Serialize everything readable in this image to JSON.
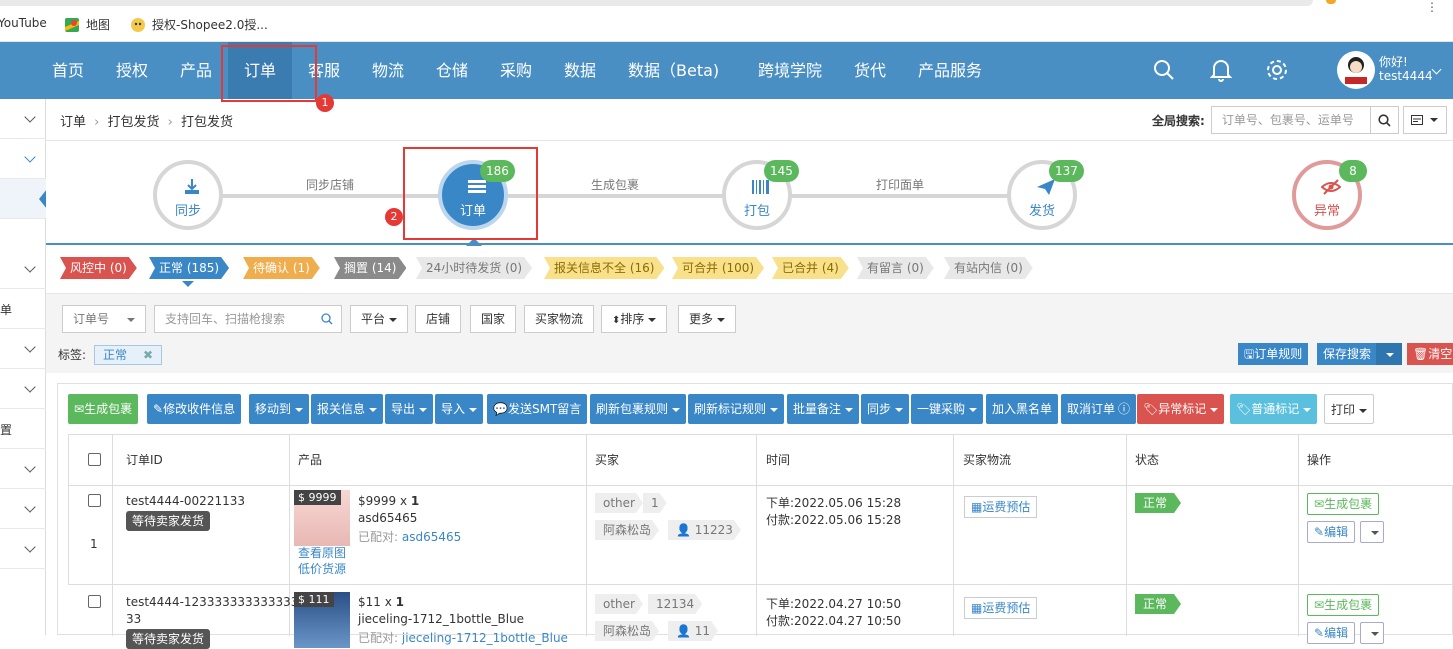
{
  "bookmarks": [
    "YouTube",
    "地图",
    "授权-Shopee2.0授..."
  ],
  "nav": {
    "items": [
      "首页",
      "授权",
      "产品",
      "订单",
      "客服",
      "物流",
      "仓储",
      "采购",
      "数据",
      "数据（Beta)",
      "跨境学院",
      "货代",
      "产品服务"
    ],
    "greeting": "你好!",
    "username": "test4444",
    "annotation1": "1"
  },
  "breadcrumb": {
    "a": "订单",
    "b": "打包发货",
    "c": "打包发货"
  },
  "global_search": {
    "label": "全局搜索:",
    "placeholder": "订单号、包裹号、运单号"
  },
  "flow": {
    "steps": [
      {
        "label": "同步",
        "count": ""
      },
      {
        "label": "订单",
        "count": "186"
      },
      {
        "label": "打包",
        "count": "145"
      },
      {
        "label": "发货",
        "count": "137"
      },
      {
        "label": "异常",
        "count": "8"
      }
    ],
    "links": [
      "同步店铺",
      "生成包裹",
      "打印面单"
    ],
    "annotation2": "2"
  },
  "status_tags": [
    {
      "label": "风控中 (0)",
      "color": "#d9534f"
    },
    {
      "label": "正常 (185)",
      "color": "#3a87c8"
    },
    {
      "label": "待确认 (1)",
      "color": "#f0ad4e"
    },
    {
      "label": "搁置 (14)",
      "color": "#8a8a8a"
    },
    {
      "label": "24小时待发货 (0)",
      "color": "#e8e8e8"
    },
    {
      "label": "报关信息不全 (16)",
      "color": "#f9e08a"
    },
    {
      "label": "可合并 (100)",
      "color": "#f9e08a"
    },
    {
      "label": "已合并 (4)",
      "color": "#f9e08a"
    },
    {
      "label": "有留言 (0)",
      "color": "#e8e8e8"
    },
    {
      "label": "有站内信 (0)",
      "color": "#e8e8e8"
    }
  ],
  "filters": {
    "order_no": "订单号",
    "search_placeholder": "支持回车、扫描枪搜索",
    "platform": "平台",
    "shop": "店铺",
    "country": "国家",
    "buyer_logistics": "买家物流",
    "sort": "排序",
    "more": "更多",
    "tag_label": "标签:",
    "tag_chip": "正常",
    "order_rule": "订单规则",
    "save_search": "保存搜索",
    "clear": "清空"
  },
  "toolbar": [
    "生成包裹",
    "修改收件信息",
    "移动到",
    "报关信息",
    "导出",
    "导入",
    "发送SMT留言",
    "刷新包裹规则",
    "刷新标记规则",
    "批量备注",
    "同步",
    "一键采购",
    "加入黑名单",
    "取消订单",
    "异常标记",
    "普通标记",
    "打印"
  ],
  "table": {
    "headers": [
      "订单ID",
      "产品",
      "买家",
      "时间",
      "买家物流",
      "状态",
      "操作"
    ],
    "rows": [
      {
        "order_id": "test4444-00221133",
        "status_pill": "等待卖家发货",
        "index": "1",
        "price_tag": "$ 9999",
        "price_line": "$9999 x ",
        "qty": "1",
        "sku": "asd65465",
        "matched_label": "已配对:",
        "matched_value": "asd65465",
        "view_img": "查看原图",
        "low_price": "低价货源",
        "buyer_tag1": "other",
        "buyer_tag2": "1",
        "buyer_name": "阿森松岛",
        "buyer_id": "11223",
        "order_time": "下单:2022.05.06 15:28",
        "pay_time": "付款:2022.05.06 15:28",
        "waybill": "运费预估",
        "status": "正常",
        "act_generate": "生成包裹",
        "act_edit": "编辑"
      },
      {
        "order_id": "test4444-123333333333333",
        "order_id2": "33",
        "status_pill": "等待卖家发货",
        "price_tag": "$ 111",
        "price_line": "$11 x ",
        "qty": "1",
        "sku": "jieceling-1712_1bottle_Blue",
        "matched_label": "已配对:",
        "matched_value": "jieceling-1712_1bottle_Blue",
        "buyer_tag1": "other",
        "buyer_tag2": "12134",
        "buyer_name": "阿森松岛",
        "buyer_id": "11",
        "order_time": "下单:2022.04.27 10:50",
        "pay_time": "付款:2022.04.27 10:50",
        "waybill": "运费预估",
        "status": "正常",
        "act_generate": "生成包裹",
        "act_edit": "编辑"
      }
    ]
  },
  "colors": {
    "nav": "#4a8fc4",
    "primary": "#3a87c8",
    "success": "#5cb85c",
    "danger": "#d9534f"
  }
}
